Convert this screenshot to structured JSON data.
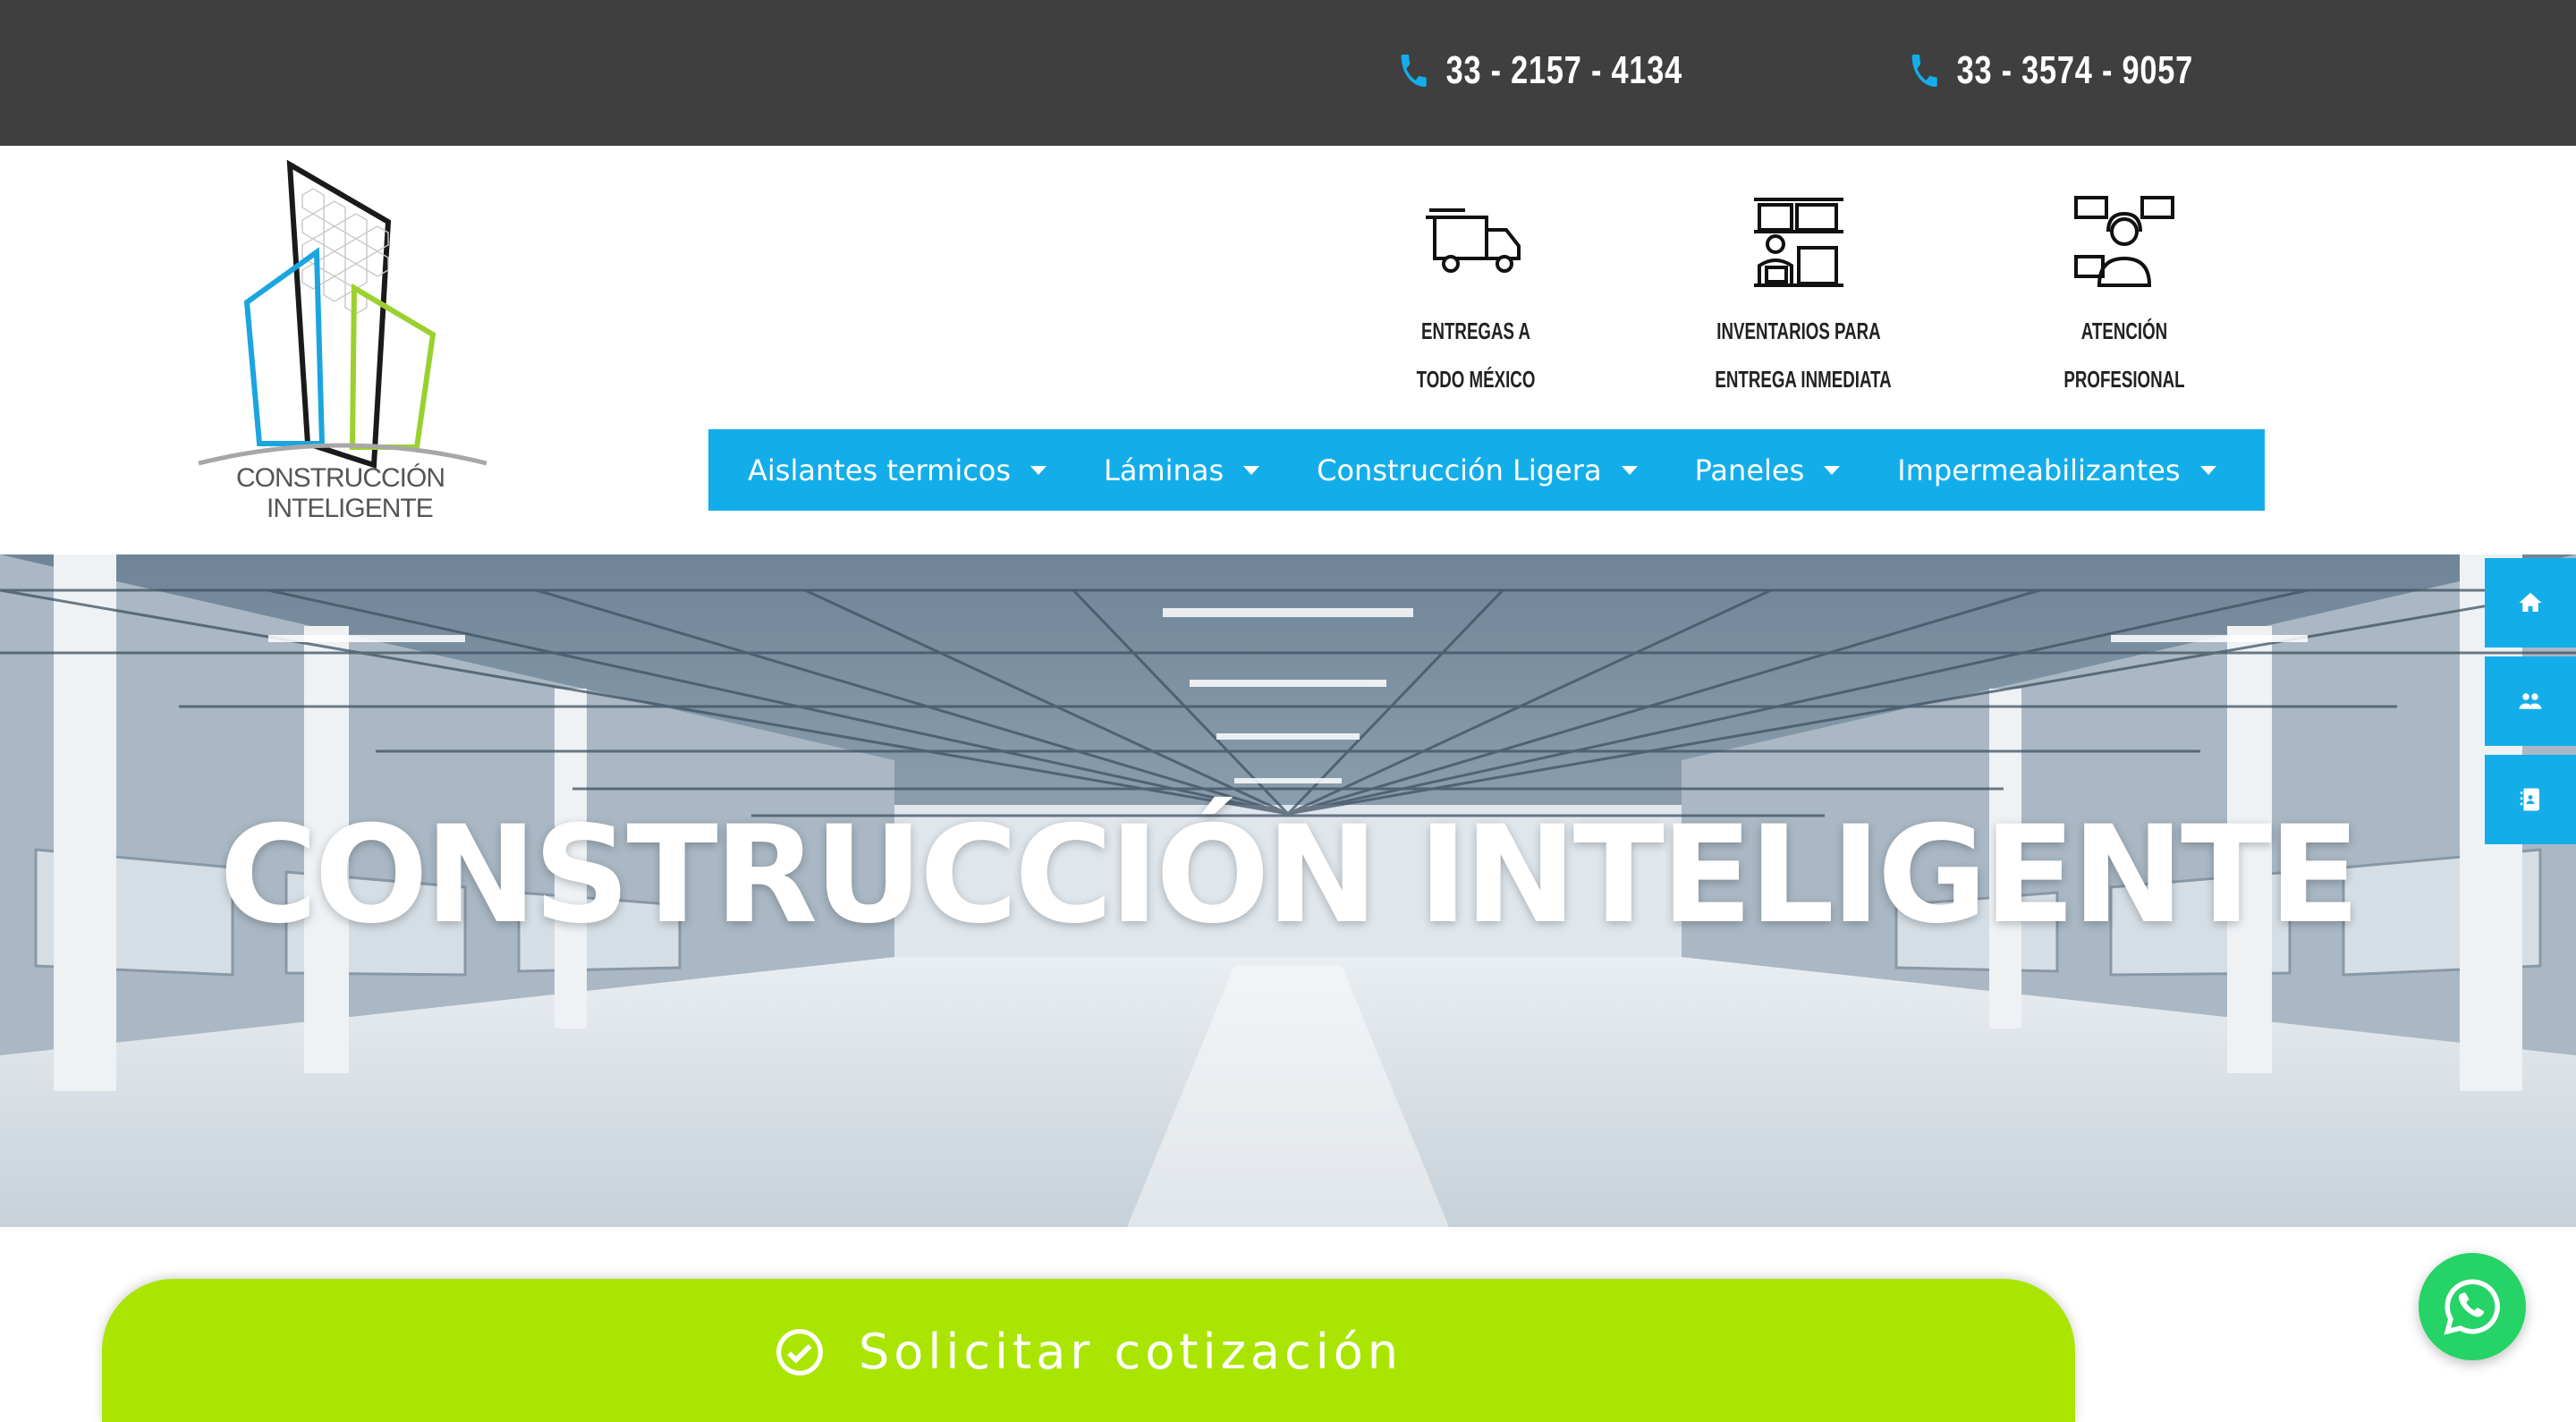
{
  "topbar": {
    "phone1": "33 - 2157 - 4134",
    "phone2": "33 - 3574 - 9057"
  },
  "logo": {
    "line1": "CONSTRUCCIÓN",
    "line2": "INTELIGENTE"
  },
  "features": [
    {
      "line1": "ENTREGAS A",
      "line2": "TODO MÉXICO",
      "icon": "truck-icon"
    },
    {
      "line1": "INVENTARIOS PARA",
      "line2": "ENTREGA INMEDIATA",
      "icon": "inventory-icon"
    },
    {
      "line1": "ATENCIÓN",
      "line2": "PROFESIONAL",
      "icon": "customer-service-icon"
    }
  ],
  "nav": {
    "items": [
      {
        "label": "Aislantes termicos"
      },
      {
        "label": "Láminas"
      },
      {
        "label": "Construcción Ligera"
      },
      {
        "label": "Paneles"
      },
      {
        "label": "Impermeabilizantes"
      }
    ]
  },
  "hero": {
    "title": "CONSTRUCCIÓN INTELIGENTE"
  },
  "side_buttons": [
    "home-icon",
    "users-icon",
    "contacts-icon"
  ],
  "quote": {
    "label": "Solicitar cotización"
  },
  "colors": {
    "topbar": "#3f3f3f",
    "accent_blue": "#13aeea",
    "accent_green": "#a9e500",
    "whatsapp": "#25d366"
  }
}
